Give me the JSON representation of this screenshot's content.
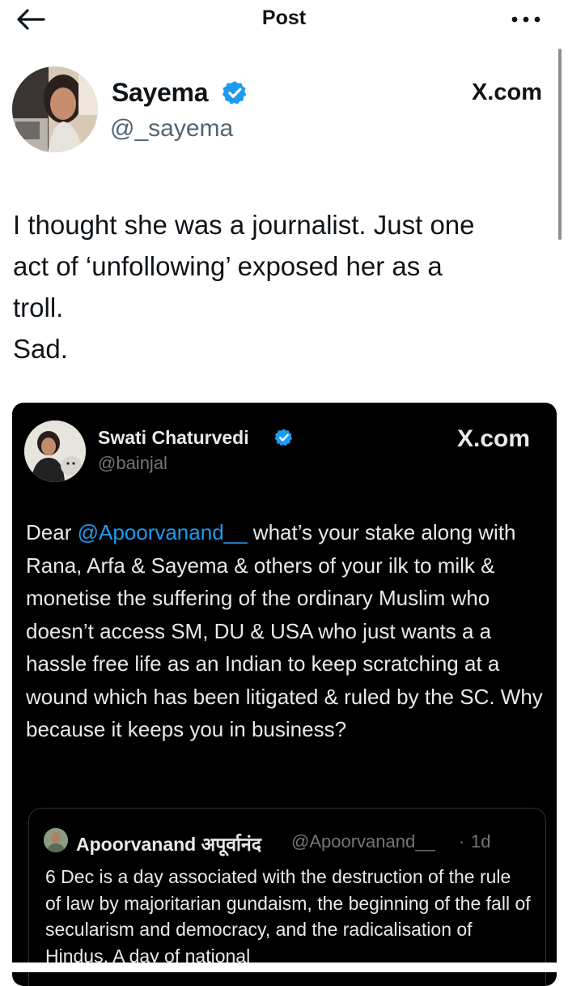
{
  "header": {
    "title": "Post",
    "back_icon": "arrow-left-icon",
    "more_icon": "more-horizontal-icon"
  },
  "post": {
    "author": {
      "name": "Sayema",
      "handle": "@_sayema",
      "verified": true
    },
    "source_label": "X.com",
    "text_lines": [
      "I thought she was a journalist. Just one",
      "act of ‘unfollowing’ exposed her as a",
      "troll.",
      "Sad."
    ]
  },
  "embedded_post": {
    "author": {
      "name": "Swati Chaturvedi",
      "handle": "@bainjal",
      "verified": true
    },
    "source_label": "X.com",
    "text": {
      "prefix": "Dear ",
      "mention": "@Apoorvanand__",
      "suffix": " what’s your stake along with Rana, Arfa & Sayema & others of your ilk to milk & monetise the suffering of the ordinary Muslim who doesn’t access SM, DU & USA who just wants a a hassle free life as an Indian to keep scratching at a wound which has been litigated & ruled by the SC. Why because it keeps you in business?"
    },
    "quoted_post": {
      "author_name": "Apoorvanand अपूर्वानंद",
      "handle": "@Apoorvanand__",
      "dot": "·",
      "time": "1d",
      "text": "6 Dec is a day associated with the destruction of the rule of law by majoritarian gundaism, the beginning of the fall of secularism and democracy, and the radicalisation of Hindus. A day of national"
    }
  },
  "colors": {
    "background": "#ffffff",
    "card_background": "#000000",
    "link": "#1d9bf0",
    "verified": "#1d9bf0",
    "secondary_text_light": "#536471",
    "secondary_text_dark": "#71767b"
  }
}
